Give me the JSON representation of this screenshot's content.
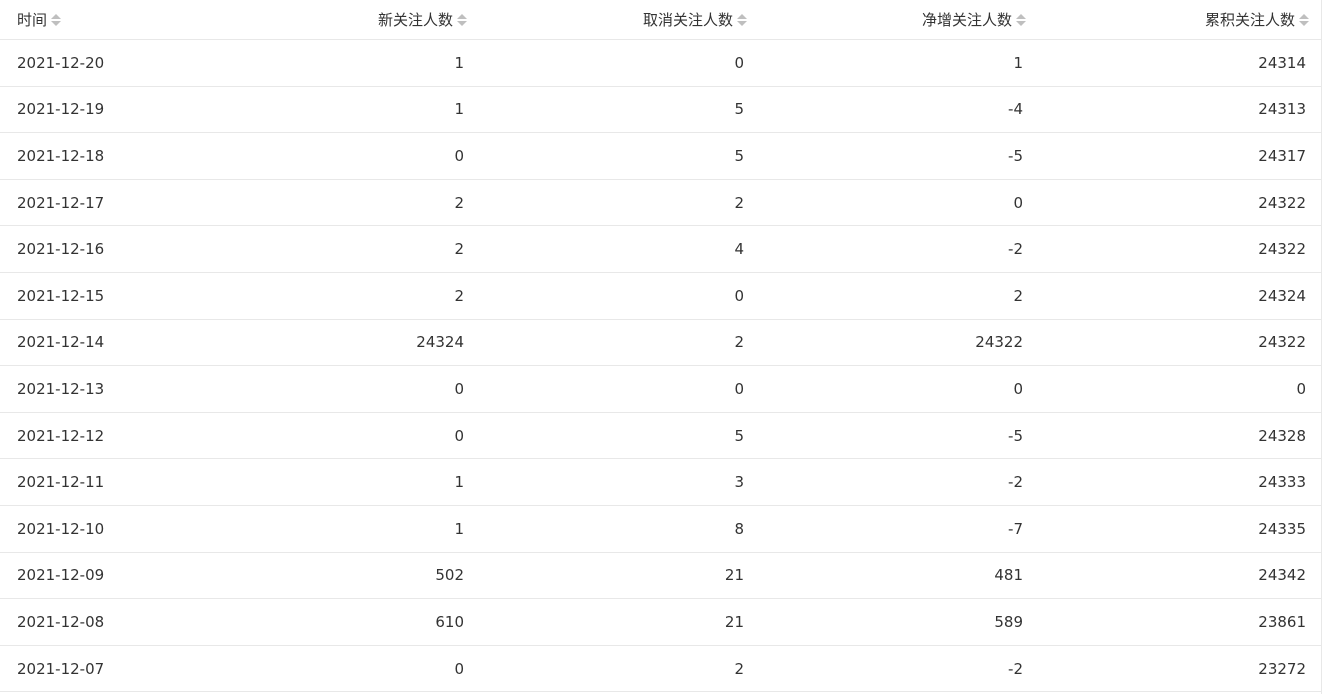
{
  "table": {
    "columns": [
      {
        "key": "date",
        "label": "时间",
        "align": "left",
        "icon": "sort-icon"
      },
      {
        "key": "new_followers",
        "label": "新关注人数",
        "align": "right",
        "icon": "sort-icon"
      },
      {
        "key": "unfollows",
        "label": "取消关注人数",
        "align": "right",
        "icon": "sort-icon"
      },
      {
        "key": "net_growth",
        "label": "净增关注人数",
        "align": "right",
        "icon": "sort-icon"
      },
      {
        "key": "cumulative",
        "label": "累积关注人数",
        "align": "right",
        "icon": "sort-icon"
      }
    ],
    "rows": [
      [
        "2021-12-20",
        "1",
        "0",
        "1",
        "24314"
      ],
      [
        "2021-12-19",
        "1",
        "5",
        "-4",
        "24313"
      ],
      [
        "2021-12-18",
        "0",
        "5",
        "-5",
        "24317"
      ],
      [
        "2021-12-17",
        "2",
        "2",
        "0",
        "24322"
      ],
      [
        "2021-12-16",
        "2",
        "4",
        "-2",
        "24322"
      ],
      [
        "2021-12-15",
        "2",
        "0",
        "2",
        "24324"
      ],
      [
        "2021-12-14",
        "24324",
        "2",
        "24322",
        "24322"
      ],
      [
        "2021-12-13",
        "0",
        "0",
        "0",
        "0"
      ],
      [
        "2021-12-12",
        "0",
        "5",
        "-5",
        "24328"
      ],
      [
        "2021-12-11",
        "1",
        "3",
        "-2",
        "24333"
      ],
      [
        "2021-12-10",
        "1",
        "8",
        "-7",
        "24335"
      ],
      [
        "2021-12-09",
        "502",
        "21",
        "481",
        "24342"
      ],
      [
        "2021-12-08",
        "610",
        "21",
        "589",
        "23861"
      ],
      [
        "2021-12-07",
        "0",
        "2",
        "-2",
        "23272"
      ]
    ]
  },
  "colors": {
    "text": "#333333",
    "border": "#e8e8e8",
    "sort_icon": "#bfbfbf",
    "background": "#ffffff"
  }
}
